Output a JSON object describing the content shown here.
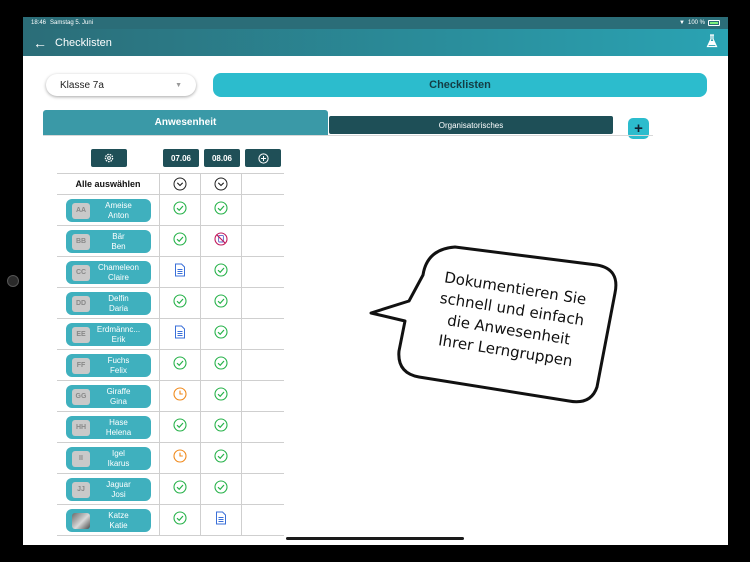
{
  "status_bar": {
    "time": "18:46",
    "date": "Samstag 5. Juni",
    "battery": "100 %"
  },
  "appbar": {
    "title": "Checklisten",
    "back_icon": "arrow-left-icon",
    "action_icon": "flask-icon"
  },
  "class_select": {
    "value": "Klasse 7a"
  },
  "checklist_button": {
    "label": "Checklisten"
  },
  "tabs": [
    {
      "label": "Anwesenheit",
      "active": true
    },
    {
      "label": "Organisatorisches",
      "active": false
    }
  ],
  "table": {
    "dates": [
      "07.06",
      "08.06"
    ],
    "select_all_label": "Alle auswählen",
    "rows": [
      {
        "initials": "AA",
        "first": "Ameise",
        "last": "Anton",
        "photo": false,
        "status": [
          "present",
          "present"
        ]
      },
      {
        "initials": "BB",
        "first": "Bär",
        "last": "Ben",
        "photo": false,
        "status": [
          "present",
          "absent"
        ]
      },
      {
        "initials": "CC",
        "first": "Chameleon",
        "last": "Claire",
        "photo": false,
        "status": [
          "document",
          "present"
        ]
      },
      {
        "initials": "DD",
        "first": "Delfin",
        "last": "Daria",
        "photo": false,
        "status": [
          "present",
          "present"
        ]
      },
      {
        "initials": "EE",
        "first": "Erdmännc...",
        "last": "Erik",
        "photo": false,
        "status": [
          "document",
          "present"
        ]
      },
      {
        "initials": "FF",
        "first": "Fuchs",
        "last": "Felix",
        "photo": false,
        "status": [
          "present",
          "present"
        ]
      },
      {
        "initials": "GG",
        "first": "Giraffe",
        "last": "Gina",
        "photo": false,
        "status": [
          "late",
          "present"
        ]
      },
      {
        "initials": "HH",
        "first": "Hase",
        "last": "Helena",
        "photo": false,
        "status": [
          "present",
          "present"
        ]
      },
      {
        "initials": "II",
        "first": "Igel",
        "last": "Ikarus",
        "photo": false,
        "status": [
          "late",
          "present"
        ]
      },
      {
        "initials": "JJ",
        "first": "Jaguar",
        "last": "Josi",
        "photo": false,
        "status": [
          "present",
          "present"
        ]
      },
      {
        "initials": "",
        "first": "Katze",
        "last": "Katie",
        "photo": true,
        "status": [
          "present",
          "document"
        ]
      }
    ]
  },
  "callout": {
    "lines": [
      "Dokumentieren Sie",
      "schnell und einfach",
      "die Anwesenheit",
      "Ihrer Lerngruppen"
    ]
  },
  "colors": {
    "present": "#27b24a",
    "absent": "#c2185b",
    "late": "#f08a1c",
    "document": "#3a6fd8",
    "accent": "#2cbccd",
    "dark": "#1f4f57"
  }
}
